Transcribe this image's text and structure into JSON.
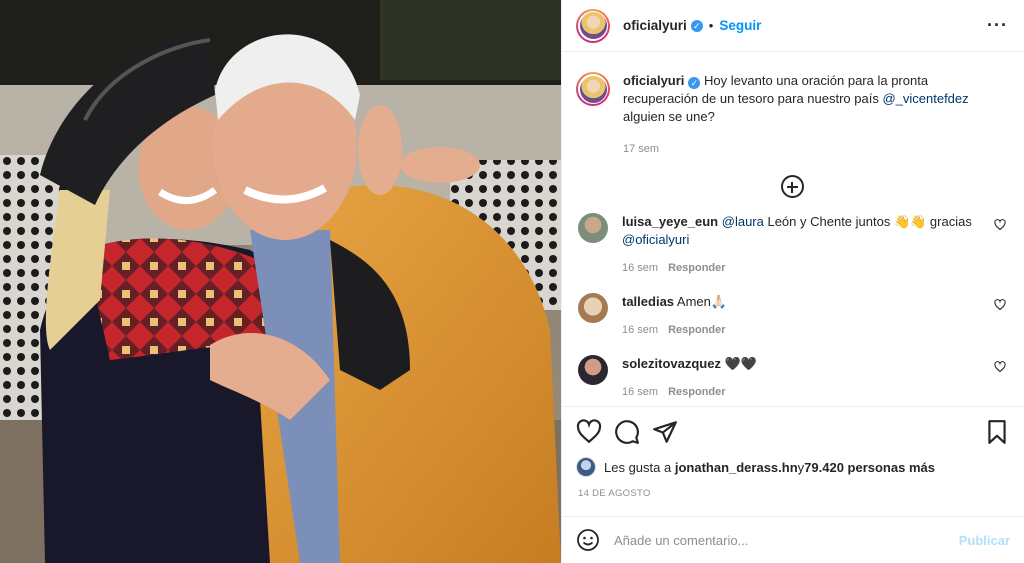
{
  "post": {
    "username": "oficialyuri",
    "follow_label": "Seguir",
    "dot": "•",
    "more_label": "···",
    "verified_mark": "✓",
    "icons": {
      "verified": "verified-badge-icon",
      "options": "more-options-icon",
      "load_more": "plus-circle-icon",
      "like": "heart-icon",
      "comment": "comment-bubble-icon",
      "share": "paper-plane-icon",
      "save": "bookmark-icon",
      "emoji": "smiley-icon"
    },
    "colors": {
      "link": "#0095f6",
      "mention": "#00376b",
      "muted": "#8e8e8e",
      "publish_disabled": "#b2dffc"
    }
  },
  "caption": {
    "username": "oficialyuri",
    "text_before": " Hoy levanto una oración para la pronta recuperación de un tesoro para nuestro país ",
    "mention": "@_vicentefdez",
    "text_after": " alguien se une?",
    "time": "17 sem"
  },
  "comments": [
    {
      "username": "luisa_yeye_eun",
      "mention": "@laura",
      "text": " León y Chente juntos 👋👋 gracias ",
      "mention2": "@oficialyuri",
      "time": "16 sem",
      "reply_label": "Responder"
    },
    {
      "username": "talledias",
      "text": " Amen🙏🏻",
      "time": "16 sem",
      "reply_label": "Responder"
    },
    {
      "username": "solezitovazquez",
      "text": " 🖤🖤",
      "time": "16 sem",
      "reply_label": "Responder"
    }
  ],
  "likes": {
    "prefix": "Les gusta a ",
    "user": "jonathan_derass.hn",
    "middle": " y ",
    "count": "79.420 personas más"
  },
  "date": "14 DE AGOSTO",
  "add_comment": {
    "placeholder": "Añade un comentario...",
    "publish_label": "Publicar"
  }
}
